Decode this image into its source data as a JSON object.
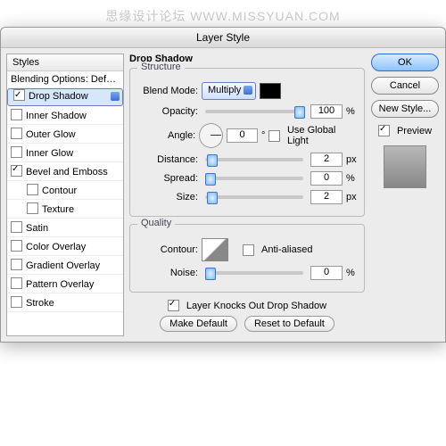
{
  "watermark": "思缘设计论坛  WWW.MISSYUAN.COM",
  "title": "Layer Style",
  "sidebar": {
    "header": "Styles",
    "blending": "Blending Options: Default",
    "items": [
      {
        "label": "Drop Shadow",
        "checked": true,
        "selected": true
      },
      {
        "label": "Inner Shadow",
        "checked": false
      },
      {
        "label": "Outer Glow",
        "checked": false
      },
      {
        "label": "Inner Glow",
        "checked": false
      },
      {
        "label": "Bevel and Emboss",
        "checked": true
      },
      {
        "label": "Contour",
        "checked": false,
        "indent": true
      },
      {
        "label": "Texture",
        "checked": false,
        "indent": true
      },
      {
        "label": "Satin",
        "checked": false
      },
      {
        "label": "Color Overlay",
        "checked": false
      },
      {
        "label": "Gradient Overlay",
        "checked": false
      },
      {
        "label": "Pattern Overlay",
        "checked": false
      },
      {
        "label": "Stroke",
        "checked": false
      }
    ]
  },
  "panel": {
    "title": "Drop Shadow",
    "structure": {
      "legend": "Structure",
      "blendmode_label": "Blend Mode:",
      "blendmode_value": "Multiply",
      "opacity_label": "Opacity:",
      "opacity_value": "100",
      "opacity_unit": "%",
      "angle_label": "Angle:",
      "angle_value": "0",
      "angle_unit": "°",
      "use_global": "Use Global Light",
      "distance_label": "Distance:",
      "distance_value": "2",
      "spread_label": "Spread:",
      "spread_value": "0",
      "size_label": "Size:",
      "size_value": "2",
      "px": "px",
      "pct": "%"
    },
    "quality": {
      "legend": "Quality",
      "contour_label": "Contour:",
      "anti": "Anti-aliased",
      "noise_label": "Noise:",
      "noise_value": "0",
      "pct": "%"
    },
    "knockout": "Layer Knocks Out Drop Shadow",
    "make_default": "Make Default",
    "reset_default": "Reset to Default"
  },
  "right": {
    "ok": "OK",
    "cancel": "Cancel",
    "new_style": "New Style...",
    "preview": "Preview"
  }
}
